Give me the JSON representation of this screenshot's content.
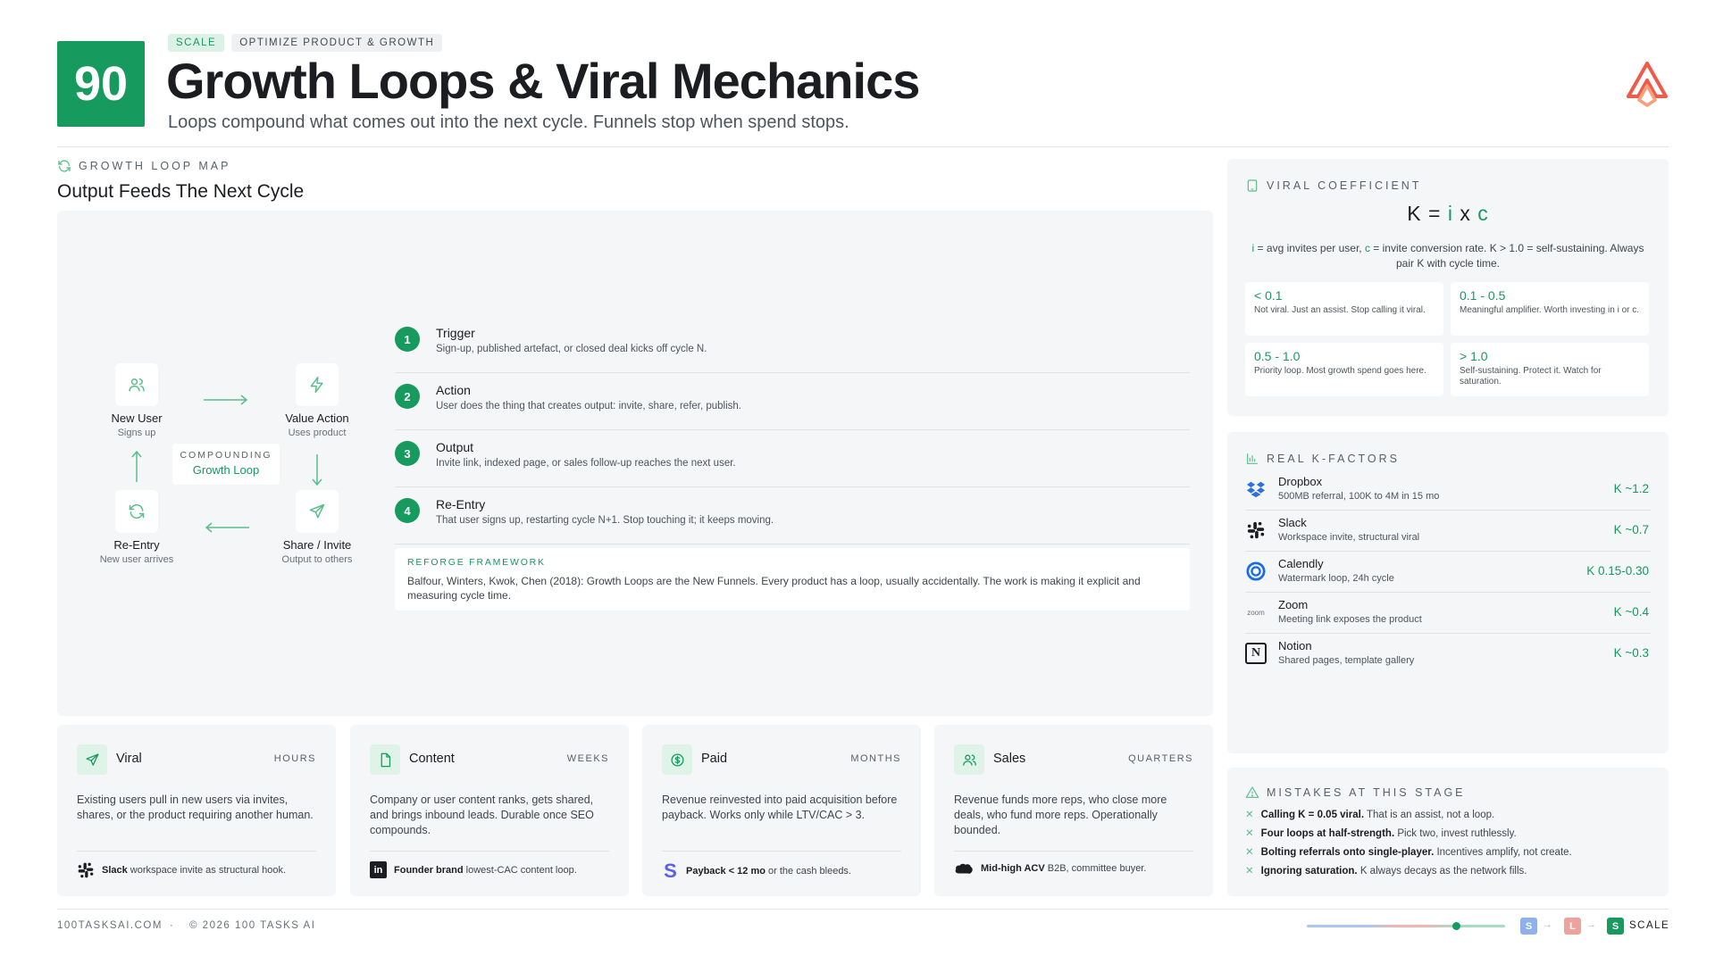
{
  "header": {
    "number": "90",
    "tags": [
      "SCALE",
      "OPTIMIZE PRODUCT & GROWTH"
    ],
    "title": "Growth Loops & Viral Mechanics",
    "subtitle": "Loops compound what comes out into the next cycle. Funnels stop when spend stops."
  },
  "loop_map": {
    "section_label": "GROWTH LOOP MAP",
    "title": "Output Feeds The Next Cycle",
    "nodes": [
      {
        "title": "New User",
        "sub": "Signs up",
        "icon": "users-icon"
      },
      {
        "title": "Value Action",
        "sub": "Uses product",
        "icon": "bolt-icon"
      },
      {
        "title": "Share / Invite",
        "sub": "Output to others",
        "icon": "send-icon"
      },
      {
        "title": "Re-Entry",
        "sub": "New user arrives",
        "icon": "refresh-icon"
      }
    ],
    "center": {
      "label": "COMPOUNDING",
      "value": "Growth Loop"
    },
    "steps": [
      {
        "n": "1",
        "title": "Trigger",
        "desc": "Sign-up, published artefact, or closed deal kicks off cycle N."
      },
      {
        "n": "2",
        "title": "Action",
        "desc": "User does the thing that creates output: invite, share, refer, publish."
      },
      {
        "n": "3",
        "title": "Output",
        "desc": "Invite link, indexed page, or sales follow-up reaches the next user."
      },
      {
        "n": "4",
        "title": "Re-Entry",
        "desc": "That user signs up, restarting cycle N+1. Stop touching it; it keeps moving."
      }
    ],
    "reforge": {
      "title": "REFORGE FRAMEWORK",
      "text": "Balfour, Winters, Kwok, Chen (2018): Growth Loops are the New Funnels. Every product has a loop, usually accidentally. The work is making it explicit and measuring cycle time."
    }
  },
  "viral_coefficient": {
    "section_label": "VIRAL COEFFICIENT",
    "formula": {
      "k": "K",
      "eq": "=",
      "i": "i",
      "x": "x",
      "c": "c"
    },
    "note": {
      "i": "i",
      "t1": " = avg invites per user, ",
      "c": "c",
      "t2": " = invite conversion rate. K > 1.0 = self-sustaining. Always pair K with cycle time."
    },
    "ranges": [
      {
        "range": "< 0.1",
        "desc": "Not viral. Just an assist. Stop calling it viral."
      },
      {
        "range": "0.1 - 0.5",
        "desc": "Meaningful amplifier. Worth investing in i or c."
      },
      {
        "range": "0.5 - 1.0",
        "desc": "Priority loop. Most growth spend goes here."
      },
      {
        "range": "> 1.0",
        "desc": "Self-sustaining. Protect it. Watch for saturation."
      }
    ]
  },
  "real_k_factors": {
    "section_label": "REAL K-FACTORS",
    "rows": [
      {
        "name": "Dropbox",
        "desc": "500MB referral, 100K to 4M in 15 mo",
        "k": "K ~1.2",
        "logo": "dropbox-logo"
      },
      {
        "name": "Slack",
        "desc": "Workspace invite, structural viral",
        "k": "K ~0.7",
        "logo": "slack-logo"
      },
      {
        "name": "Calendly",
        "desc": "Watermark loop, 24h cycle",
        "k": "K 0.15-0.30",
        "logo": "calendly-logo"
      },
      {
        "name": "Zoom",
        "desc": "Meeting link exposes the product",
        "k": "K ~0.4",
        "logo": "zoom-logo",
        "logo_text": "zoom"
      },
      {
        "name": "Notion",
        "desc": "Shared pages, template gallery",
        "k": "K ~0.3",
        "logo": "notion-logo",
        "logo_text": "N"
      }
    ]
  },
  "mistakes": {
    "section_label": "MISTAKES AT THIS STAGE",
    "items": [
      {
        "bold": "Calling K = 0.05 viral.",
        "text": " That is an assist, not a loop."
      },
      {
        "bold": "Four loops at half-strength.",
        "text": " Pick two, invest ruthlessly."
      },
      {
        "bold": "Bolting referrals onto single-player.",
        "text": " Incentives amplify, not create."
      },
      {
        "bold": "Ignoring saturation.",
        "text": " K always decays as the network fills."
      }
    ]
  },
  "loop_types": [
    {
      "name": "Viral",
      "speed": "HOURS",
      "icon": "send-icon",
      "desc": "Existing users pull in new users via invites, shares, or the product requiring another human.",
      "ex_bold": "Slack",
      "ex_text": " workspace invite as structural hook.",
      "ex_logo": "slack-logo"
    },
    {
      "name": "Content",
      "speed": "WEEKS",
      "icon": "document-icon",
      "desc": "Company or user content ranks, gets shared, and brings inbound leads. Durable once SEO compounds.",
      "ex_bold": "Founder brand",
      "ex_text": " lowest-CAC content loop.",
      "ex_logo": "linkedin-logo",
      "ex_logo_text": "in"
    },
    {
      "name": "Paid",
      "speed": "MONTHS",
      "icon": "dollar-icon",
      "desc": "Revenue reinvested into paid acquisition before payback. Works only while LTV/CAC > 3.",
      "ex_bold": "Payback < 12 mo",
      "ex_text": " or the cash bleeds.",
      "ex_logo": "stripe-logo",
      "ex_logo_text": "S"
    },
    {
      "name": "Sales",
      "speed": "QUARTERS",
      "icon": "users-icon",
      "desc": "Revenue funds more reps, who close more deals, who fund more reps. Operationally bounded.",
      "ex_bold": "Mid-high ACV",
      "ex_text": " B2B, committee buyer.",
      "ex_logo": "salesforce-logo"
    }
  ],
  "footer": {
    "site": "100TASKSAI.COM",
    "sep": "·",
    "copyright": "© 2026 100 TASKS AI",
    "stages": [
      {
        "letter": "S",
        "color": "#8fb0ea"
      },
      {
        "letter": "L",
        "color": "#eea29b"
      },
      {
        "letter": "S",
        "color": "#169a5e"
      }
    ],
    "current_stage": "SCALE",
    "progress": 0.75
  },
  "colors": {
    "accent": "#169a5e",
    "light_accent": "#5bbd8c",
    "panel": "#f5f6f8"
  }
}
